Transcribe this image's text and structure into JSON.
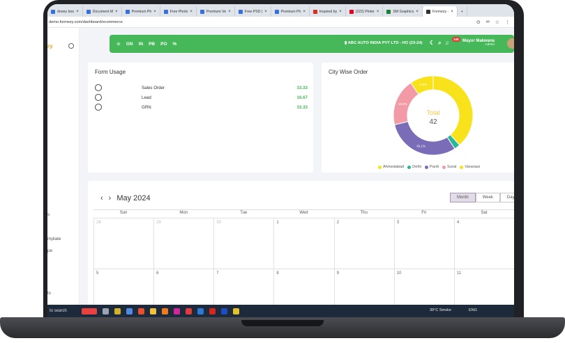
{
  "browser": {
    "tabs": [
      {
        "label": "dooey boo",
        "color": "#3b6fd8"
      },
      {
        "label": "Document M",
        "color": "#3b6fd8"
      },
      {
        "label": "Premium Ph",
        "color": "#3b6fd8"
      },
      {
        "label": "Free Photo",
        "color": "#3b6fd8"
      },
      {
        "label": "Premium Ve",
        "color": "#3b6fd8"
      },
      {
        "label": "Free PSD | ",
        "color": "#3b6fd8"
      },
      {
        "label": "Premium Ph",
        "color": "#3b6fd8"
      },
      {
        "label": "Inspired by",
        "color": "#d93025"
      },
      {
        "label": "(222) Pinter",
        "color": "#e60023"
      },
      {
        "label": "SM Graphics",
        "color": "#1a7f37"
      },
      {
        "label": "Formezy - ",
        "color": "#333333"
      }
    ],
    "url": "demo.formezy.com/dashboard/ecommerce"
  },
  "sidebar": {
    "logo": "ry",
    "items": [
      "s",
      "mplate",
      "pe",
      "ts"
    ]
  },
  "topnav": {
    "quick_links": [
      "GN",
      "IN",
      "PB",
      "PO",
      "%"
    ],
    "company": "ABC AUTO INDIA PVT LTD - HO (23-24)",
    "notification_count": "108",
    "user_name": "Mayur Makwana",
    "user_role": "Admin"
  },
  "form_usage": {
    "title": "Form Usage",
    "rows": [
      {
        "label": "Sales Order",
        "value": "33.33"
      },
      {
        "label": "Lead",
        "value": "16.67"
      },
      {
        "label": "GRN",
        "value": "33.33"
      }
    ]
  },
  "city_wise_order": {
    "title": "City Wise Order",
    "center_label": "Total",
    "center_value": "42"
  },
  "chart_data": {
    "type": "pie",
    "title": "City Wise Order",
    "categories": [
      "Ahmedabad",
      "Delhi",
      "Pardi",
      "Surat",
      "Varanasi"
    ],
    "values": [
      38.1,
      2.4,
      30.1,
      19.0,
      9.5
    ],
    "slice_labels": [
      "",
      "",
      "30.1%",
      "19.0%",
      "9.5%"
    ],
    "colors": [
      "#f7e21b",
      "#2bb69b",
      "#7b6cb8",
      "#f29aa5",
      "#f7e21b"
    ],
    "legend_placement": "bottom"
  },
  "calendar": {
    "month_label": "May 2024",
    "views": [
      "Month",
      "Week",
      "Day"
    ],
    "active_view": "Month",
    "day_headers": [
      "Sun",
      "Mon",
      "Tue",
      "Wed",
      "Thu",
      "Fri",
      "Sat"
    ],
    "week1": [
      "28",
      "29",
      "30",
      "1",
      "2",
      "3",
      "4"
    ],
    "week2": [
      "5",
      "6",
      "7",
      "8",
      "9",
      "10",
      "11"
    ]
  },
  "taskbar": {
    "search": "to search",
    "weather": "39°C Smoke",
    "tray": "ENG"
  }
}
